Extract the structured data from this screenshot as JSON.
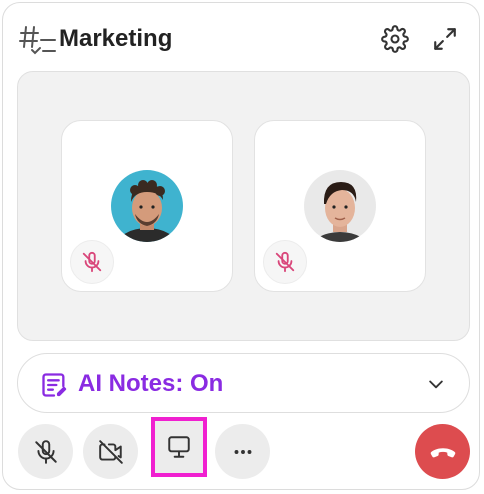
{
  "header": {
    "title": "Marketing",
    "channel_icon": "hash-list-icon",
    "settings_icon": "gear-icon",
    "expand_icon": "expand-arrows-icon"
  },
  "participants": [
    {
      "avatar": "curly-hair-man-avatar",
      "muted": true
    },
    {
      "avatar": "dark-hair-man-avatar",
      "muted": true
    }
  ],
  "ai_notes": {
    "label": "AI Notes: On",
    "icon": "notes-edit-icon",
    "accent": "#8a2be2"
  },
  "controls": {
    "mute": "mic-off-icon",
    "camera": "video-off-icon",
    "screen_share": "monitor-icon",
    "more": "ellipsis-icon",
    "hang_up": "phone-hangup-icon",
    "hang_up_color": "#dd4c4f",
    "highlight_color": "#f020d0"
  }
}
